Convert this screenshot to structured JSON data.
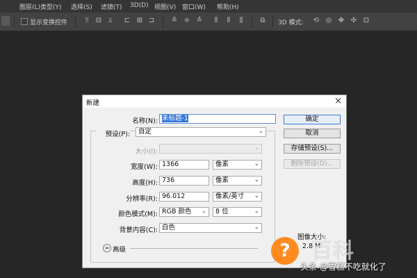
{
  "menubar": {
    "items": [
      "图层(L)",
      "类型(Y)",
      "选择(S)",
      "滤镜(T)",
      "3D(D)",
      "视图(V)",
      "窗口(W)",
      "帮助(H)"
    ]
  },
  "options_bar": {
    "show_transform_controls": "显示变换控件",
    "mode_3d_label": "3D 模式:"
  },
  "dialog": {
    "title": "新建",
    "close_label": "×",
    "name_label": "名称(N):",
    "name_value": "未标题-1",
    "preset_label": "预设(P):",
    "preset_value": "自定",
    "size_label": "大小(I):",
    "size_value": "",
    "width_label": "宽度(W):",
    "width_value": "1366",
    "width_unit": "像素",
    "height_label": "高度(H):",
    "height_value": "736",
    "height_unit": "像素",
    "resolution_label": "分辨率(R):",
    "resolution_value": "96.012",
    "resolution_unit": "像素/英寸",
    "color_mode_label": "颜色模式(M):",
    "color_mode_value": "RGB 颜色",
    "bit_depth_value": "8 位",
    "background_label": "背景内容(C):",
    "background_value": "白色",
    "advanced_label": "高级",
    "advanced_toggle": "≫",
    "ok_button": "确定",
    "cancel_button": "取消",
    "save_preset_button": "存储预设(S)...",
    "delete_preset_button": "删除预设(D)...",
    "image_size_label": "图像大小:",
    "image_size_value": "2.8 M"
  },
  "watermark": {
    "brand": "百科",
    "credit": "头条 @雪糕不吃就化了"
  }
}
